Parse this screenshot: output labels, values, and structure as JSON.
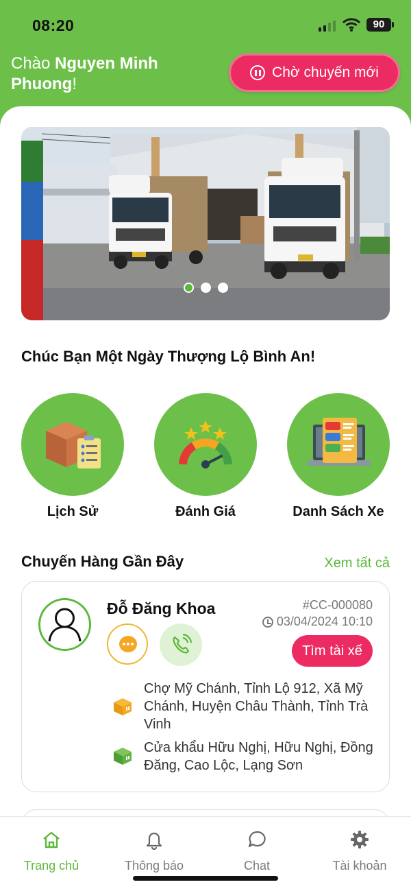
{
  "status_bar": {
    "time": "08:20",
    "battery": "90"
  },
  "header": {
    "greeting_prefix": "Chào ",
    "user_name": "Nguyen Minh Phuong",
    "greeting_suffix": "!",
    "wait_button_label": "Chờ chuyến mới"
  },
  "banner": {
    "slide_count": 3,
    "active_slide": 1
  },
  "wish_text": "Chúc Bạn Một Ngày Thượng Lộ Bình An!",
  "features": [
    {
      "label": "Lịch Sử",
      "icon": "box-checklist-icon"
    },
    {
      "label": "Đánh Giá",
      "icon": "rating-gauge-icon"
    },
    {
      "label": "Danh Sách Xe",
      "icon": "vehicle-list-icon"
    }
  ],
  "recent": {
    "title": "Chuyến Hàng Gần Đây",
    "see_all": "Xem tất cả",
    "trips": [
      {
        "driver_name": "Đỗ Đăng Khoa",
        "code": "#CC-000080",
        "datetime": "03/04/2024 10:10",
        "action_label": "Tìm tài xế",
        "from": "Chợ Mỹ Chánh, Tỉnh Lộ 912, Xã Mỹ Chánh, Huyện Châu Thành, Tỉnh Trà Vinh",
        "to": "Cửa khẩu Hữu Nghị, Hữu Nghị, Đồng Đăng, Cao Lộc, Lạng Sơn"
      }
    ]
  },
  "tabs": [
    {
      "label": "Trang chủ",
      "icon": "home-icon",
      "active": true
    },
    {
      "label": "Thông báo",
      "icon": "bell-icon",
      "active": false
    },
    {
      "label": "Chat",
      "icon": "chat-icon",
      "active": false
    },
    {
      "label": "Tài khoản",
      "icon": "gear-icon",
      "active": false
    }
  ],
  "colors": {
    "brand_green": "#6cc04a",
    "accent_pink": "#ec2b63",
    "link_green": "#5cb83a"
  }
}
